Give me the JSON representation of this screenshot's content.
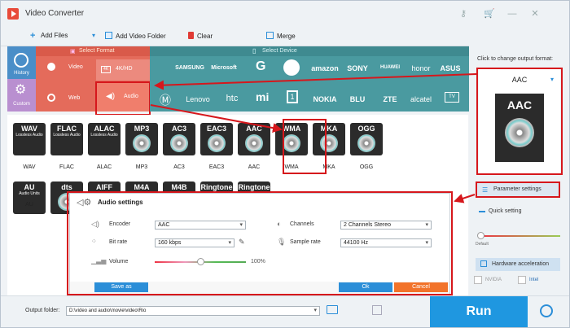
{
  "window": {
    "title": "Video Converter"
  },
  "toolbar": {
    "add_files": "Add Files",
    "add_video_folder": "Add Video Folder",
    "clear": "Clear",
    "merge": "Merge"
  },
  "category": {
    "select_format": "Select Format",
    "select_device": "Select Device",
    "history": "History",
    "custom": "Custom",
    "video": "Video",
    "hd": "4K/HD",
    "web": "Web",
    "audio": "Audio"
  },
  "brands_row1": [
    "SAMSUNG",
    "Microsoft",
    "amazon",
    "SONY",
    "HUAWEI",
    "honor",
    "ASUS"
  ],
  "brands_row2": [
    "Lenovo",
    "htc",
    "NOKIA",
    "BLU",
    "ZTE",
    "alcatel",
    "TV"
  ],
  "formats_row1": [
    {
      "name": "WAV",
      "sub": "Lossless Audio",
      "label": "WAV"
    },
    {
      "name": "FLAC",
      "sub": "Lossless Audio",
      "label": "FLAC"
    },
    {
      "name": "ALAC",
      "sub": "Lossless Audio",
      "label": "ALAC"
    },
    {
      "name": "MP3",
      "sub": "",
      "label": "MP3"
    },
    {
      "name": "AC3",
      "sub": "",
      "label": "AC3"
    },
    {
      "name": "EAC3",
      "sub": "",
      "label": "EAC3"
    },
    {
      "name": "AAC",
      "sub": "",
      "label": "AAC"
    },
    {
      "name": "WMA",
      "sub": "",
      "label": "WMA"
    },
    {
      "name": "MKA",
      "sub": "",
      "label": "MKA"
    },
    {
      "name": "OGG",
      "sub": "",
      "label": "OGG"
    }
  ],
  "formats_row2": [
    {
      "name": "AU",
      "sub": "Audio Units",
      "label": "AU"
    },
    {
      "name": "dts",
      "sub": "",
      "label": ""
    },
    {
      "name": "AIFF",
      "sub": "",
      "label": ""
    },
    {
      "name": "M4A",
      "sub": "",
      "label": ""
    },
    {
      "name": "M4B",
      "sub": "",
      "label": ""
    },
    {
      "name": "Ringtone",
      "sub": "",
      "label": ""
    },
    {
      "name": "Ringtone",
      "sub": "",
      "label": ""
    }
  ],
  "settings": {
    "title": "Audio settings",
    "encoder_label": "Encoder",
    "encoder_value": "AAC",
    "bitrate_label": "Bit rate",
    "bitrate_value": "160 kbps",
    "volume_label": "Volume",
    "volume_value": "100%",
    "volume_level": 0.5,
    "channels_label": "Channels",
    "channels_value": "2 Channels Stereo",
    "samplerate_label": "Sample rate",
    "samplerate_value": "44100 Hz",
    "save_as": "Save as",
    "ok": "Ok",
    "cancel": "Cancel"
  },
  "right_panel": {
    "change_format": "Click to change output format:",
    "output_format": "AAC",
    "output_icon_text": "AAC",
    "parameter_settings": "Parameter settings",
    "quick_setting": "Quick setting",
    "default": "Default",
    "hw_accel": "Hardware acceleration",
    "nvidia": "NVIDIA",
    "intel": "Intel"
  },
  "bottom": {
    "output_folder_label": "Output folder:",
    "output_folder_path": "D:\\video and audio\\movie\\video\\Rio",
    "run": "Run"
  },
  "colors": {
    "accent": "#2b8ed8",
    "highlight": "#d6171c",
    "run": "#1f97e0",
    "cancel": "#f2732a"
  }
}
